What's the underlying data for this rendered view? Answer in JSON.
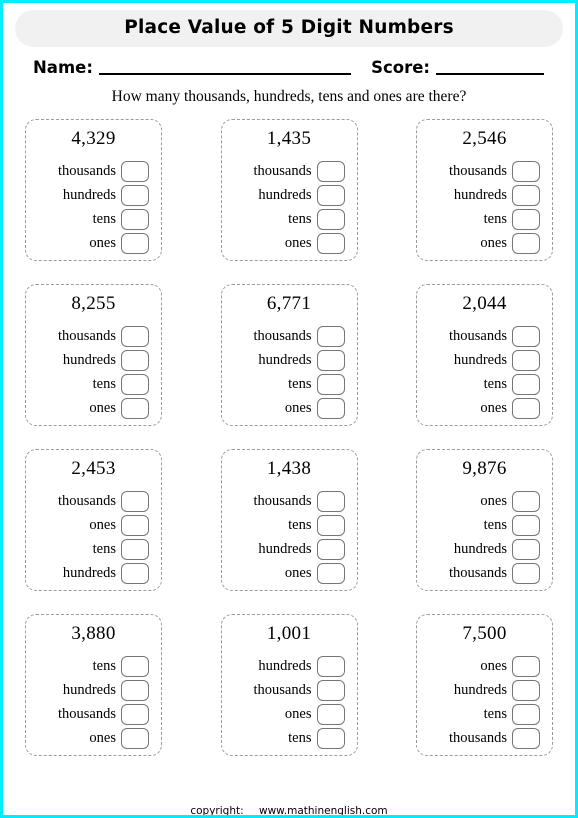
{
  "page": {
    "border_color": "#00eeff",
    "title": "Place Value of 5 Digit Numbers",
    "title_pill_color": "#f1f1f1"
  },
  "fields": {
    "name_label": "Name:",
    "score_label": "Score:"
  },
  "instruction": "How many thousands, hundreds, tens and ones are there?",
  "cards": [
    {
      "number": "4,329",
      "rows": [
        {
          "label": "thousands"
        },
        {
          "label": "hundreds"
        },
        {
          "label": "tens"
        },
        {
          "label": "ones"
        }
      ]
    },
    {
      "number": "1,435",
      "rows": [
        {
          "label": "thousands"
        },
        {
          "label": "hundreds"
        },
        {
          "label": "tens"
        },
        {
          "label": "ones"
        }
      ]
    },
    {
      "number": "2,546",
      "rows": [
        {
          "label": "thousands"
        },
        {
          "label": "hundreds"
        },
        {
          "label": "tens"
        },
        {
          "label": "ones"
        }
      ]
    },
    {
      "number": "8,255",
      "rows": [
        {
          "label": "thousands"
        },
        {
          "label": "hundreds"
        },
        {
          "label": "tens"
        },
        {
          "label": "ones"
        }
      ]
    },
    {
      "number": "6,771",
      "rows": [
        {
          "label": "thousands"
        },
        {
          "label": "hundreds"
        },
        {
          "label": "tens"
        },
        {
          "label": "ones"
        }
      ]
    },
    {
      "number": "2,044",
      "rows": [
        {
          "label": "thousands"
        },
        {
          "label": "hundreds"
        },
        {
          "label": "tens"
        },
        {
          "label": "ones"
        }
      ]
    },
    {
      "number": "2,453",
      "rows": [
        {
          "label": "thousands"
        },
        {
          "label": "ones"
        },
        {
          "label": "tens"
        },
        {
          "label": "hundreds"
        }
      ]
    },
    {
      "number": "1,438",
      "rows": [
        {
          "label": "thousands"
        },
        {
          "label": "tens"
        },
        {
          "label": "hundreds"
        },
        {
          "label": "ones"
        }
      ]
    },
    {
      "number": "9,876",
      "rows": [
        {
          "label": "ones"
        },
        {
          "label": "tens"
        },
        {
          "label": "hundreds"
        },
        {
          "label": "thousands"
        }
      ]
    },
    {
      "number": "3,880",
      "rows": [
        {
          "label": "tens"
        },
        {
          "label": "hundreds"
        },
        {
          "label": "thousands"
        },
        {
          "label": "ones"
        }
      ]
    },
    {
      "number": "1,001",
      "rows": [
        {
          "label": "hundreds"
        },
        {
          "label": "thousands"
        },
        {
          "label": "ones"
        },
        {
          "label": "tens"
        }
      ]
    },
    {
      "number": "7,500",
      "rows": [
        {
          "label": "ones"
        },
        {
          "label": "hundreds"
        },
        {
          "label": "tens"
        },
        {
          "label": "thousands"
        }
      ]
    }
  ],
  "footer": {
    "copyright_label": "copyright:",
    "site": "www.mathinenglish.com"
  }
}
